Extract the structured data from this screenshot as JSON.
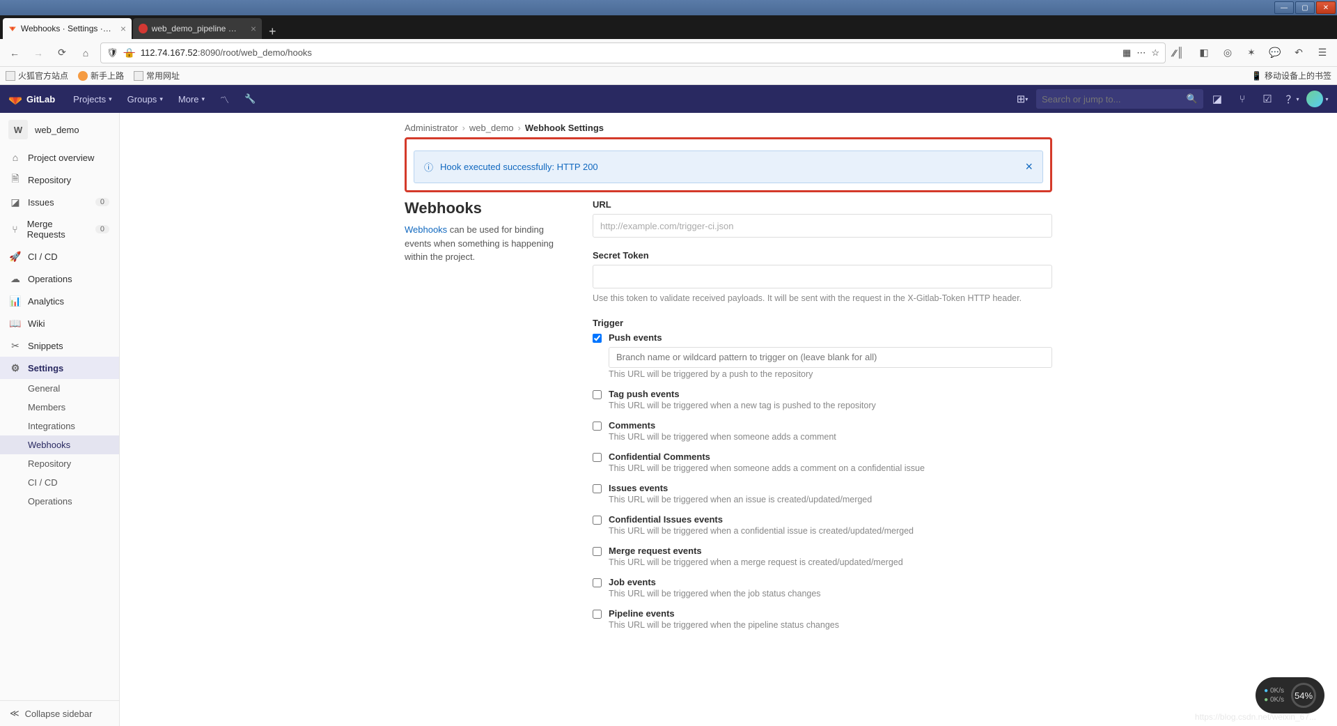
{
  "window": {
    "min": "—",
    "max": "▢",
    "close": "✕"
  },
  "tabs": [
    {
      "title": "Webhooks · Settings · Admin",
      "active": true,
      "icon": "gitlab"
    },
    {
      "title": "web_demo_pipeline Config",
      "active": false,
      "icon": "jenkins"
    }
  ],
  "browser": {
    "url_display": "112.74.167.52:8090/root/web_demo/hooks",
    "host": "112.74.167.52",
    "port_path": ":8090/root/web_demo/hooks",
    "bookmarks": [
      "火狐官方站点",
      "新手上路",
      "常用网址"
    ],
    "mobile_bookmark": "移动设备上的书签"
  },
  "gitlab_nav": {
    "brand": "GitLab",
    "items": [
      "Projects",
      "Groups",
      "More"
    ],
    "search_placeholder": "Search or jump to..."
  },
  "project_name": "web_demo",
  "project_initial": "W",
  "sidebar": {
    "items": [
      {
        "label": "Project overview",
        "icon": "home"
      },
      {
        "label": "Repository",
        "icon": "file"
      },
      {
        "label": "Issues",
        "icon": "issues",
        "badge": "0"
      },
      {
        "label": "Merge Requests",
        "icon": "merge",
        "badge": "0"
      },
      {
        "label": "CI / CD",
        "icon": "rocket"
      },
      {
        "label": "Operations",
        "icon": "cloud"
      },
      {
        "label": "Analytics",
        "icon": "chart"
      },
      {
        "label": "Wiki",
        "icon": "book"
      },
      {
        "label": "Snippets",
        "icon": "scissors"
      },
      {
        "label": "Settings",
        "icon": "gear",
        "active": true
      }
    ],
    "subs": [
      "General",
      "Members",
      "Integrations",
      "Webhooks",
      "Repository",
      "CI / CD",
      "Operations"
    ],
    "active_sub": "Webhooks",
    "collapse": "Collapse sidebar"
  },
  "breadcrumb": {
    "root": "Administrator",
    "project": "web_demo",
    "current": "Webhook Settings"
  },
  "alert": {
    "text": "Hook executed successfully: HTTP 200"
  },
  "webhooks": {
    "title": "Webhooks",
    "desc_link": "Webhooks",
    "desc_rest": " can be used for binding events when something is happening within the project."
  },
  "form": {
    "url_label": "URL",
    "url_placeholder": "http://example.com/trigger-ci.json",
    "token_label": "Secret Token",
    "token_help": "Use this token to validate received payloads. It will be sent with the request in the X-Gitlab-Token HTTP header.",
    "trigger_label": "Trigger",
    "triggers": [
      {
        "title": "Push events",
        "checked": true,
        "has_input": true,
        "input_placeholder": "Branch name or wildcard pattern to trigger on (leave blank for all)",
        "desc": "This URL will be triggered by a push to the repository"
      },
      {
        "title": "Tag push events",
        "checked": false,
        "desc": "This URL will be triggered when a new tag is pushed to the repository"
      },
      {
        "title": "Comments",
        "checked": false,
        "desc": "This URL will be triggered when someone adds a comment"
      },
      {
        "title": "Confidential Comments",
        "checked": false,
        "desc": "This URL will be triggered when someone adds a comment on a confidential issue"
      },
      {
        "title": "Issues events",
        "checked": false,
        "desc": "This URL will be triggered when an issue is created/updated/merged"
      },
      {
        "title": "Confidential Issues events",
        "checked": false,
        "desc": "This URL will be triggered when a confidential issue is created/updated/merged"
      },
      {
        "title": "Merge request events",
        "checked": false,
        "desc": "This URL will be triggered when a merge request is created/updated/merged"
      },
      {
        "title": "Job events",
        "checked": false,
        "desc": "This URL will be triggered when the job status changes"
      },
      {
        "title": "Pipeline events",
        "checked": false,
        "desc": "This URL will be triggered when the pipeline status changes"
      }
    ]
  },
  "float_badge": {
    "up": "0K/s",
    "down": "0K/s",
    "pct": "54%"
  },
  "watermark": "https://blog.csdn.net/weixin_67..."
}
